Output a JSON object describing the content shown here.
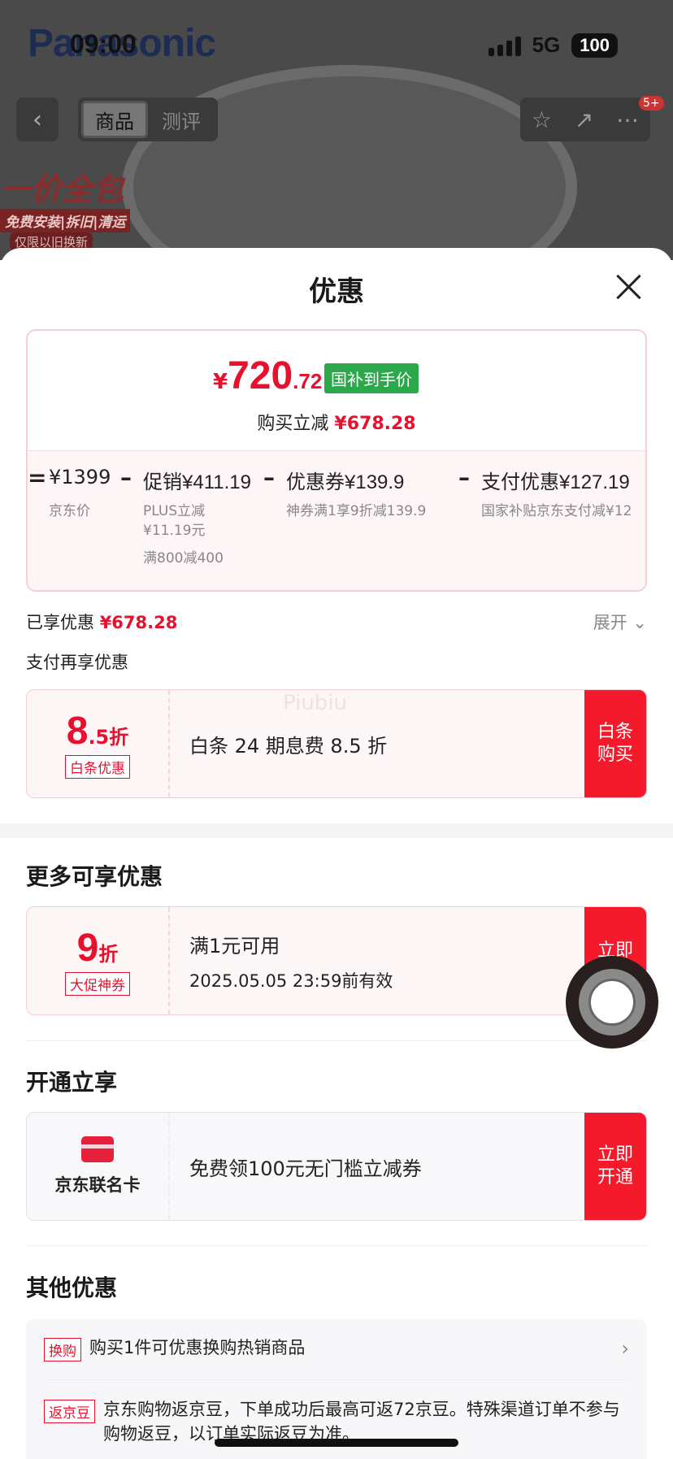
{
  "status_bar": {
    "time": "09:00",
    "network": "5G",
    "battery": "100"
  },
  "brand": "Panasonic",
  "nav": {
    "tabs": [
      "商品",
      "测评"
    ],
    "badge": "5+"
  },
  "promo_banner": {
    "title": "一价全包",
    "subtitle": "免费安装|拆旧|清运",
    "note": "仅限以旧换新"
  },
  "sheet": {
    "title": "优惠",
    "hand_price": {
      "symbol": "¥",
      "integer": "720",
      "decimal": ".72",
      "tag": "国补到手价"
    },
    "instant_discount": {
      "label": "购买立减",
      "value": "¥678.28"
    },
    "breakdown": {
      "eq": "=",
      "jd_price": {
        "value": "¥1399",
        "label": "京东价"
      },
      "promo": {
        "label": "促销",
        "value": "¥411.19",
        "sub1": "PLUS立减",
        "sub2": "¥11.19元",
        "sub3": "满800减400"
      },
      "coupon": {
        "label": "优惠券",
        "value": "¥139.9",
        "sub": "神券满1享9折减139.9"
      },
      "payment": {
        "label": "支付优惠",
        "value": "¥127.19",
        "sub": "国家补贴京东支付减¥12"
      }
    },
    "enjoyed": {
      "label": "已享优惠",
      "value": "¥678.28"
    },
    "expand": "展开",
    "pay_more": "支付再享优惠",
    "baitiao_coupon": {
      "num": "8",
      "suffix": ".5折",
      "label": "白条优惠",
      "text": "白条 24 期息费 8.5 折",
      "button": "白条\n购买",
      "watermark": "Piubiu"
    },
    "more_title": "更多可享优惠",
    "big_promo_coupon": {
      "num": "9",
      "suffix": "折",
      "label": "大促神券",
      "line1": "满1元可用",
      "line2": "2025.05.05 23:59前有效",
      "button": "立即"
    },
    "open_title": "开通立享",
    "card_offer": {
      "card_name": "京东联名卡",
      "text": "免费领100元无门槛立减券",
      "button": "立即\n开通"
    },
    "other_title": "其他优惠",
    "other": [
      {
        "tag": "换购",
        "text": "购买1件可优惠换购热销商品"
      },
      {
        "tag": "返京豆",
        "text": "京东购物返京豆，下单成功后最高可返72京豆。特殊渠道订单不参与购物返豆，以订单实际返豆为准。"
      }
    ]
  }
}
